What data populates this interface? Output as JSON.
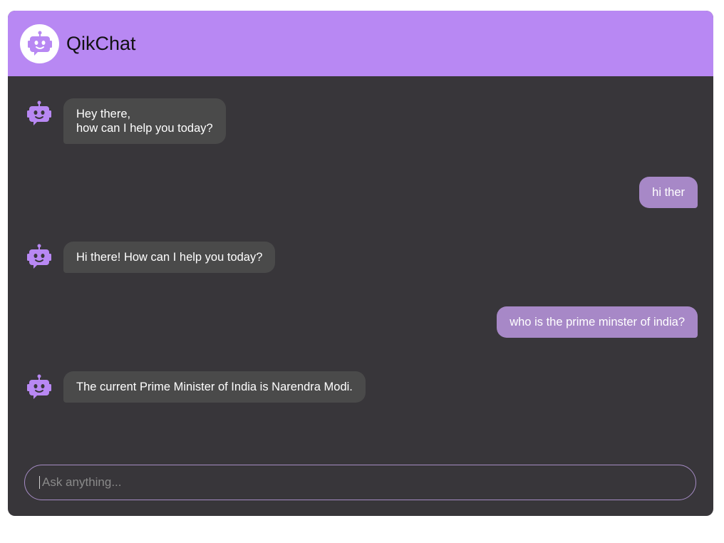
{
  "app": {
    "title": "QikChat",
    "logo_icon": "robot-icon",
    "accent_color": "#b888f3"
  },
  "messages": [
    {
      "sender": "bot",
      "text": "Hey there,\nhow can I help you today?"
    },
    {
      "sender": "user",
      "text": "hi ther"
    },
    {
      "sender": "bot",
      "text": "Hi there! How can I help you today?"
    },
    {
      "sender": "user",
      "text": "who is the prime minster of india?"
    },
    {
      "sender": "bot",
      "text": "The current Prime Minister of India is Narendra Modi."
    }
  ],
  "composer": {
    "placeholder": "Ask anything...",
    "value": ""
  }
}
